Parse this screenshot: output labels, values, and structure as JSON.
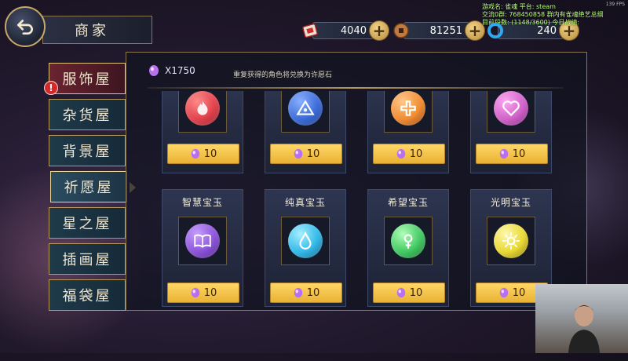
{
  "header": {
    "title": "商家",
    "currencies": [
      {
        "icon": "ticket-icon",
        "value": "4040"
      },
      {
        "icon": "coin-icon",
        "value": "81251"
      },
      {
        "icon": "jade-ring-icon",
        "value": "240"
      }
    ]
  },
  "stream_overlay": {
    "line1": "游戏名: 雀魂  平台: steam",
    "line2": "交流0群: 768450858  群内有雀魂绝艺总纲",
    "line3": "目前段数: (1148/3600) 今日战绩:",
    "fps": "139 FPS"
  },
  "nav": {
    "items": [
      "服饰屋",
      "杂货屋",
      "背景屋",
      "祈愿屋",
      "星之屋",
      "插画屋",
      "福袋屋"
    ],
    "alert": "!"
  },
  "panel": {
    "balance": "X1750",
    "note": "重复获得的角色将兑换为许愿石"
  },
  "cards": [
    {
      "name": "",
      "price": "10",
      "orb_color": "#e0404a",
      "icon": "flame-icon"
    },
    {
      "name": "",
      "price": "10",
      "orb_color": "#3a6ad8",
      "icon": "triangle-icon"
    },
    {
      "name": "",
      "price": "10",
      "orb_color": "#f08a30",
      "icon": "cross-icon"
    },
    {
      "name": "",
      "price": "10",
      "orb_color": "#d060c8",
      "icon": "heart-icon"
    },
    {
      "name": "智慧宝玉",
      "price": "10",
      "orb_color": "#8a50d8",
      "icon": "book-icon"
    },
    {
      "name": "纯真宝玉",
      "price": "10",
      "orb_color": "#30b8e8",
      "icon": "droplet-icon"
    },
    {
      "name": "希望宝玉",
      "price": "10",
      "orb_color": "#40c860",
      "icon": "sprout-icon"
    },
    {
      "name": "光明宝玉",
      "price": "10",
      "orb_color": "#e8d830",
      "icon": "sun-icon"
    }
  ]
}
